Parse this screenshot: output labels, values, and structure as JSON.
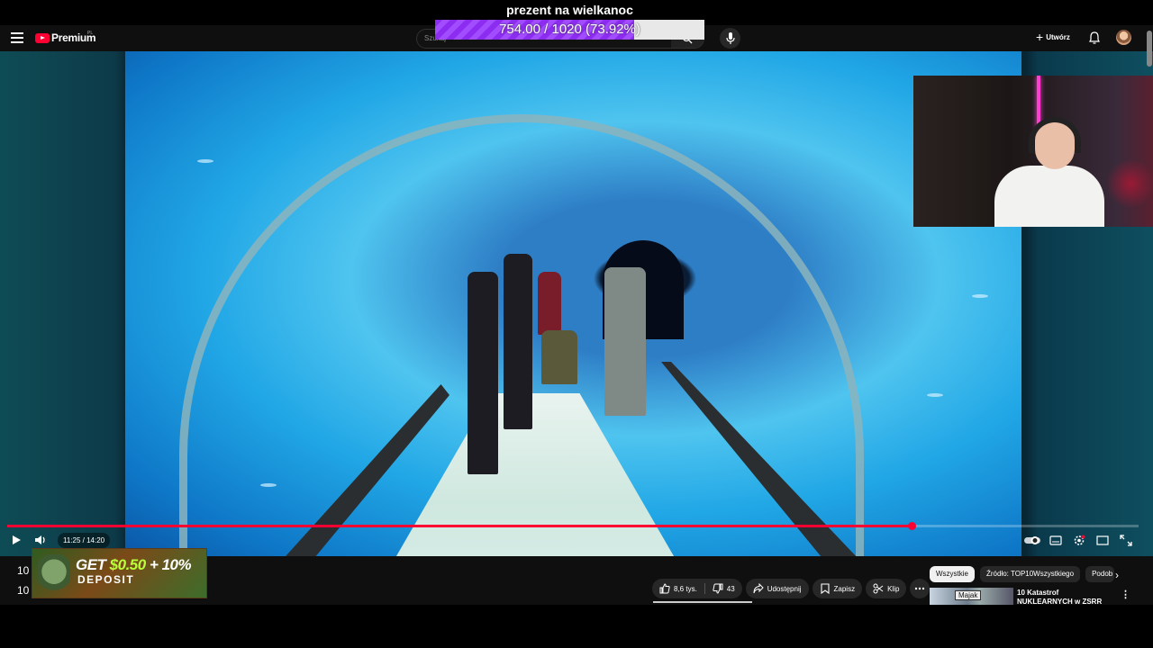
{
  "overlay": {
    "gift_title": "prezent na wielkanoc",
    "goal_text": "754.00 / 1020 (73.92%)",
    "goal_progress_fraction": 0.7392,
    "goal_fill_color": "#8c2cf0"
  },
  "header": {
    "logo_text": "Premium",
    "logo_region": "PL",
    "search_placeholder": "Szukaj",
    "create_label": "Utwórz",
    "icons": [
      "menu-icon",
      "youtube-logo-icon",
      "search-icon",
      "mic-icon",
      "plus-icon",
      "bell-icon",
      "avatar"
    ]
  },
  "player": {
    "time_display": "11:25 / 14:20",
    "progress_fraction": 0.7994,
    "accent_color": "#ff0033"
  },
  "video_meta": {
    "title_fragment_1": "10",
    "title_fragment_2": "10"
  },
  "ad": {
    "line1_prefix": "GET ",
    "line1_amount": "$0.50",
    "line1_suffix": " + 10%",
    "line2": "DEPOSIT"
  },
  "actions": {
    "like_count": "8,6 tys.",
    "dislike_count": "43",
    "share_label": "Udostępnij",
    "save_label": "Zapisz",
    "clip_label": "Klip"
  },
  "sidebar": {
    "chips": [
      "Wszystkie",
      "Źródło: TOP10Wszystkiego",
      "Podob"
    ],
    "recommended_title": "10 Katastrof NUKLEARNYCH w ZSRR",
    "recommended_badge": "Majak"
  }
}
